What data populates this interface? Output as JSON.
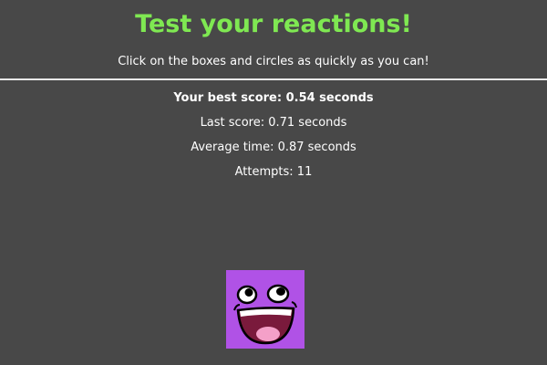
{
  "header": {
    "title": "Test your reactions!",
    "subtitle": "Click on the boxes and circles as quickly as you can!"
  },
  "stats": {
    "best": "Your best score: 0.54 seconds",
    "last": "Last score: 0.71 seconds",
    "average": "Average time: 0.87 seconds",
    "attempts": "Attempts: 11"
  },
  "target": {
    "shape": "square",
    "color": "#b052e6",
    "icon": "awesome-smiley-face-icon"
  },
  "colors": {
    "background": "#484848",
    "title": "#7fe852",
    "text": "#ffffff"
  }
}
